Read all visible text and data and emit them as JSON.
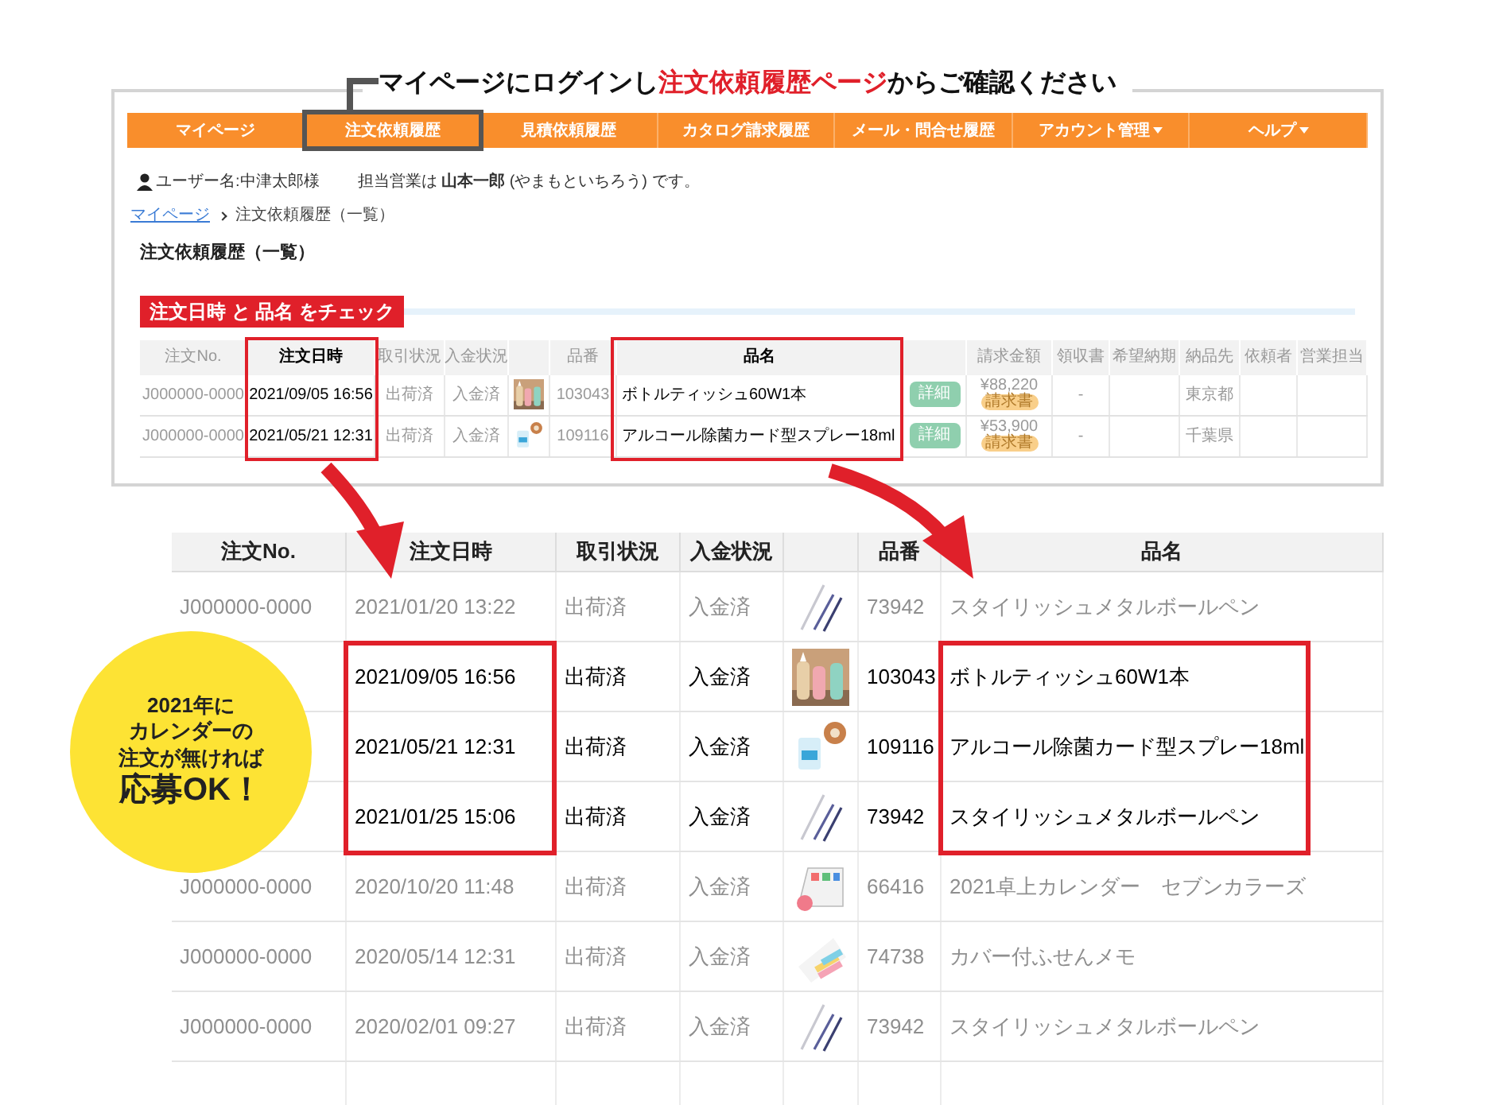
{
  "heading": {
    "before": "マイページにログインし",
    "highlight": "注文依頼履歴ページ",
    "after": "からご確認ください"
  },
  "site": {
    "nav": [
      {
        "label": "マイページ",
        "selected": false,
        "dropdown": false
      },
      {
        "label": "注文依頼履歴",
        "selected": true,
        "dropdown": false
      },
      {
        "label": "見積依頼履歴",
        "selected": false,
        "dropdown": false
      },
      {
        "label": "カタログ請求履歴",
        "selected": false,
        "dropdown": false
      },
      {
        "label": "メール・問合せ履歴",
        "selected": false,
        "dropdown": false
      },
      {
        "label": "アカウント管理",
        "selected": false,
        "dropdown": true
      },
      {
        "label": "ヘルプ",
        "selected": false,
        "dropdown": true
      }
    ],
    "user": {
      "name": "ユーザー名:中津太郎様",
      "rep": "担当営業は **山本一郎** (やまもといちろう) です。"
    },
    "breadcrumb": [
      {
        "label": "マイページ",
        "link": true
      },
      {
        "label": "注文依頼履歴（一覧）",
        "link": false
      }
    ],
    "page_title": "注文依頼履歴（一覧）",
    "check_label": "注文日時 と 品名 をチェック",
    "table": {
      "columns": [
        {
          "kind": "text",
          "label": "注文No.",
          "emphasized": false
        },
        {
          "kind": "text",
          "label": "注文日時",
          "emphasized": true
        },
        {
          "kind": "text",
          "label": "取引状況",
          "emphasized": false
        },
        {
          "kind": "text",
          "label": "入金状況",
          "emphasized": false
        },
        {
          "kind": "blank"
        },
        {
          "kind": "text",
          "label": "品番",
          "emphasized": false
        },
        {
          "kind": "text",
          "label": "品名",
          "emphasized": true
        },
        {
          "kind": "blank"
        },
        {
          "kind": "text",
          "label": "請求金額",
          "emphasized": false
        },
        {
          "kind": "text",
          "label": "領収書",
          "emphasized": false
        },
        {
          "kind": "text",
          "label": "希望納期",
          "emphasized": false
        },
        {
          "kind": "text",
          "label": "納品先",
          "emphasized": false
        },
        {
          "kind": "text",
          "label": "依頼者",
          "emphasized": false
        },
        {
          "kind": "text",
          "label": "営業担当",
          "emphasized": false
        }
      ],
      "rows": [
        {
          "order_no": "J000000-0000",
          "ordered_at": "2021/09/05 16:56",
          "deal_status": "出荷済",
          "payment_status": "入金済",
          "item_code": "103043",
          "item_name": "ボトルティッシュ60W1本",
          "detail_button": "詳細",
          "amount": "¥88,220",
          "invoice_badge": "請求書",
          "receipt": "-",
          "delivery_to": "東京都"
        },
        {
          "order_no": "J000000-0000",
          "ordered_at": "2021/05/21 12:31",
          "deal_status": "出荷済",
          "payment_status": "入金済",
          "item_code": "109116",
          "item_name": "アルコール除菌カード型スプレー18ml",
          "detail_button": "詳細",
          "amount": "¥53,900",
          "invoice_badge": "請求書",
          "receipt": "-",
          "delivery_to": "千葉県"
        }
      ]
    }
  },
  "detail_table": {
    "columns": [
      {
        "kind": "text",
        "label": "注文No."
      },
      {
        "kind": "text",
        "label": "注文日時"
      },
      {
        "kind": "text",
        "label": "取引状況"
      },
      {
        "kind": "text",
        "label": "入金状況"
      },
      {
        "kind": "blank"
      },
      {
        "kind": "text",
        "label": "品番"
      },
      {
        "kind": "text",
        "label": "品名"
      }
    ],
    "rows": [
      {
        "order_no": "J000000-0000",
        "ordered_at": "2021/01/20 13:22",
        "deal_status": "出荷済",
        "payment_status": "入金済",
        "item_code": "73942",
        "item_name": "スタイリッシュメタルボールペン",
        "highlighted": false
      },
      {
        "ordered_at": "2021/09/05 16:56",
        "deal_status": "出荷済",
        "payment_status": "入金済",
        "item_code": "103043",
        "item_name": "ボトルティッシュ60W1本",
        "highlighted": true
      },
      {
        "ordered_at": "2021/05/21 12:31",
        "deal_status": "出荷済",
        "payment_status": "入金済",
        "item_code": "109116",
        "item_name": "アルコール除菌カード型スプレー18ml",
        "highlighted": true
      },
      {
        "ordered_at": "2021/01/25 15:06",
        "deal_status": "出荷済",
        "payment_status": "入金済",
        "item_code": "73942",
        "item_name": "スタイリッシュメタルボールペン",
        "highlighted": true
      },
      {
        "order_no": "J000000-0000",
        "ordered_at": "2020/10/20 11:48",
        "deal_status": "出荷済",
        "payment_status": "入金済",
        "item_code": "66416",
        "item_name": "2021卓上カレンダー　セブンカラーズ",
        "highlighted": false
      },
      {
        "order_no": "J000000-0000",
        "ordered_at": "2020/05/14 12:31",
        "deal_status": "出荷済",
        "payment_status": "入金済",
        "item_code": "74738",
        "item_name": "カバー付ふせんメモ",
        "highlighted": false
      },
      {
        "order_no": "J000000-0000",
        "ordered_at": "2020/02/01 09:27",
        "deal_status": "出荷済",
        "payment_status": "入金済",
        "item_code": "73942",
        "item_name": "スタイリッシュメタルボールペン",
        "highlighted": false
      }
    ]
  },
  "note": {
    "lines": [
      "2021年に",
      "カレンダーの",
      "注文が無ければ",
      "応募OK！"
    ]
  }
}
